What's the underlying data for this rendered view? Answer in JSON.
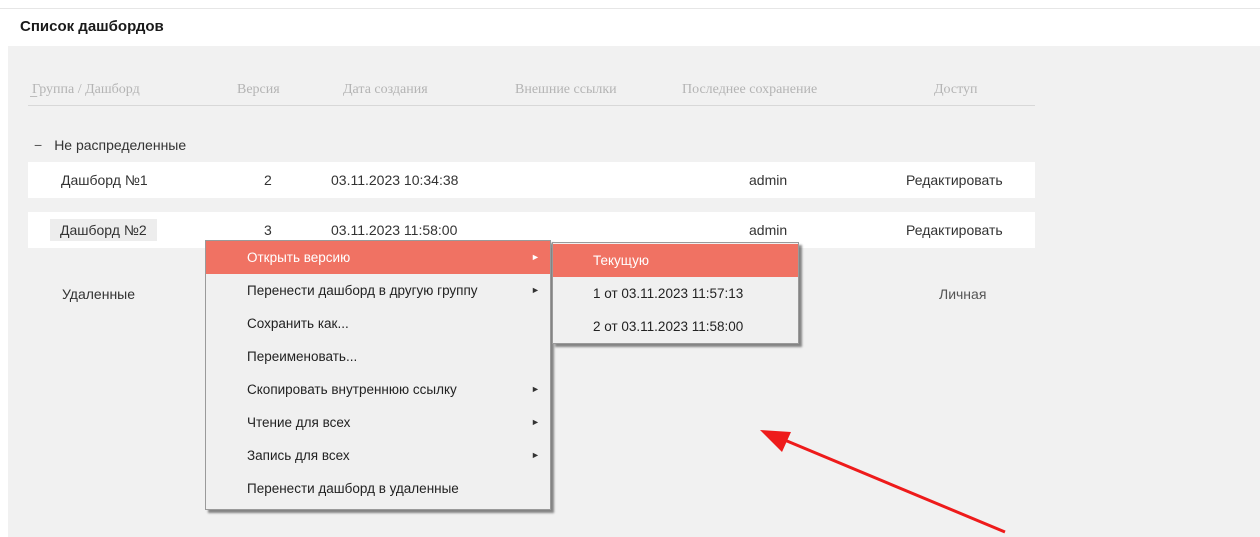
{
  "page_title": "Список дашбордов",
  "columns": {
    "group": "Группа / Дашборд",
    "group_sort": "–",
    "version": "Версия",
    "created": "Дата создания",
    "external_links": "Внешние ссылки",
    "last_saved": "Последнее сохранение",
    "access": "Доступ"
  },
  "group": {
    "toggle": "−",
    "name": "Не распределенные"
  },
  "rows": [
    {
      "name": "Дашборд №1",
      "version": "2",
      "created": "03.11.2023 10:34:38",
      "saved_by": "admin",
      "access": "Редактировать"
    },
    {
      "name": "Дашборд №2",
      "version": "3",
      "created": "03.11.2023 11:58:00",
      "saved_by": "admin",
      "access": "Редактировать"
    }
  ],
  "deleted": {
    "label": "Удаленные",
    "access": "Личная"
  },
  "context_menu": {
    "items": [
      {
        "label": "Открыть версию",
        "arrow": "►"
      },
      {
        "label": "Перенести дашборд в другую группу",
        "arrow": "►"
      },
      {
        "label": "Сохранить как...",
        "arrow": ""
      },
      {
        "label": "Переименовать...",
        "arrow": ""
      },
      {
        "label": "Скопировать внутреннюю ссылку",
        "arrow": "►"
      },
      {
        "label": "Чтение для всех",
        "arrow": "►"
      },
      {
        "label": "Запись для всех",
        "arrow": "►"
      },
      {
        "label": "Перенести дашборд в удаленные",
        "arrow": ""
      }
    ]
  },
  "version_submenu": {
    "items": [
      {
        "label": "Текущую"
      },
      {
        "label": "1 от 03.11.2023 11:57:13"
      },
      {
        "label": "2 от 03.11.2023 11:58:00"
      }
    ]
  },
  "colors": {
    "menu_highlight": "#f07263",
    "annotation_arrow": "#ee1b1b"
  }
}
